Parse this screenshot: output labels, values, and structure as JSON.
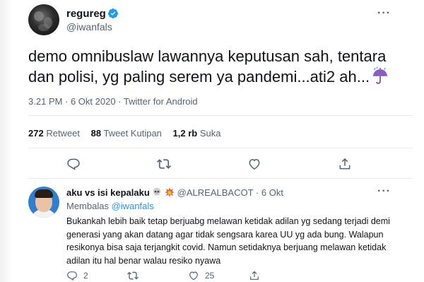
{
  "main_tweet": {
    "display_name": "regureg",
    "handle": "@iwanfals",
    "text": "demo omnibuslaw lawannya keputusan sah, tentara dan polisi, yg paling serem ya pandemi...ati2 ah...",
    "meta": "3.21 PM · 6 Okt 2020 · Twitter for Android",
    "stats": {
      "retweets_count": "272",
      "retweets_label": "Retweet",
      "quotes_count": "88",
      "quotes_label": "Tweet Kutipan",
      "likes_count": "1,2 rb",
      "likes_label": "Suka"
    },
    "more_label": "···"
  },
  "reply": {
    "display_name": "aku vs isi kepalaku",
    "handle": "@ALREALBACOT",
    "dot": "·",
    "time": "6 Okt",
    "replying_prefix": "Membalas ",
    "replying_mention": "@iwanfals",
    "text": "Bukankah lebih baik tetap berjuabg melawan ketidak adilan yg sedang terjadi demi generasi yang akan datang agar tidak sengsara karea UU yg ada bung. Walapun resikonya bisa saja terjangkit covid. Namun setidaknya berjuang melawan ketidak adilan itu hal benar walau resiko nyawa",
    "reply_count": "2",
    "like_count": "25",
    "more_label": "···"
  },
  "icons": [
    "verified-badge-icon",
    "umbrella-rain-icon",
    "reply-icon",
    "retweet-icon",
    "like-icon",
    "share-icon",
    "skull-icon",
    "collision-icon",
    "more-icon"
  ],
  "colors": {
    "accent": "#1d9bf0",
    "text": "#0f1419",
    "secondary": "#536471",
    "divider": "#e6ecf0"
  }
}
